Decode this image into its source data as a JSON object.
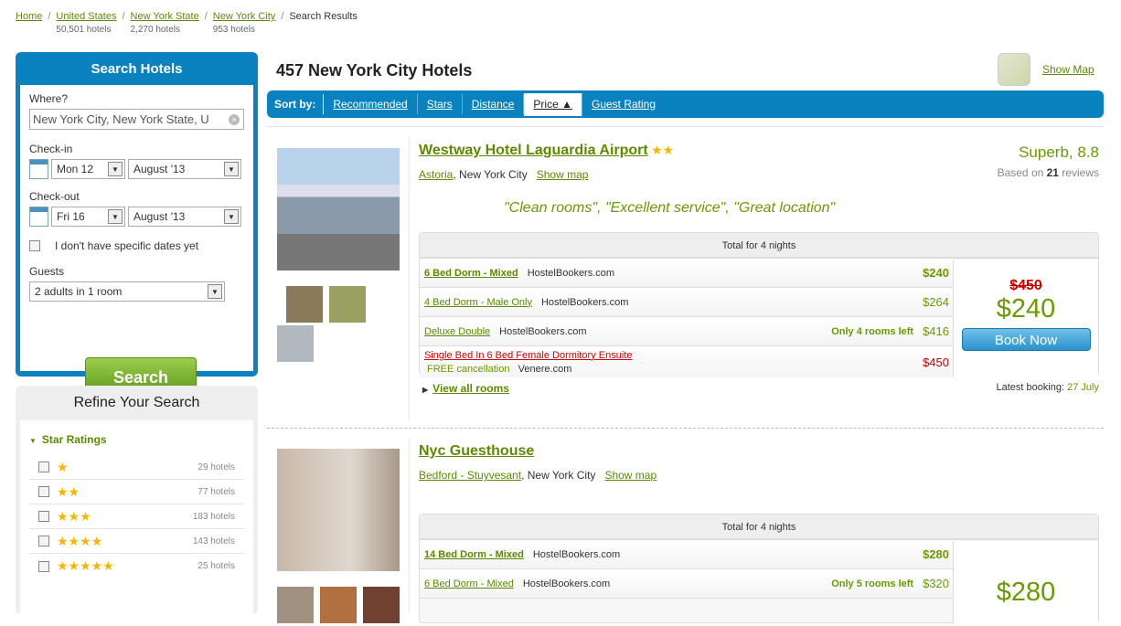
{
  "breadcrumb": [
    {
      "label": "Home",
      "count": ""
    },
    {
      "label": "United States",
      "count": "50,501 hotels"
    },
    {
      "label": "New York State",
      "count": "2,270 hotels"
    },
    {
      "label": "New York City",
      "count": "953 hotels"
    },
    {
      "label": "Search Results",
      "count": ""
    }
  ],
  "search": {
    "title": "Search Hotels",
    "where_label": "Where?",
    "where_value": "New York City, New York State, U",
    "checkin_label": "Check-in",
    "checkin_day": "Mon 12",
    "checkin_month": "August '13",
    "checkout_label": "Check-out",
    "checkout_day": "Fri 16",
    "checkout_month": "August '13",
    "no_dates_label": "I don't have specific dates yet",
    "guests_label": "Guests",
    "guests_value": "2 adults in 1 room",
    "button": "Search"
  },
  "refine": {
    "title": "Refine Your Search",
    "section": "Star Ratings",
    "items": [
      {
        "stars": "★",
        "count": "29 hotels"
      },
      {
        "stars": "★★",
        "count": "77 hotels"
      },
      {
        "stars": "★★★",
        "count": "183 hotels"
      },
      {
        "stars": "★★★★",
        "count": "143 hotels"
      },
      {
        "stars": "★★★★★",
        "count": "25 hotels"
      }
    ]
  },
  "main": {
    "title": "457 New York City Hotels",
    "show_map": "Show Map",
    "sort_label": "Sort by:",
    "sort_options": [
      "Recommended",
      "Stars",
      "Distance",
      "Price ▲",
      "Guest Rating"
    ],
    "active_sort": "Price"
  },
  "hotels": [
    {
      "name": "Westway Hotel Laguardia Airport",
      "stars": "★★",
      "area": "Astoria",
      "city": ", New York City",
      "show_map": "Show map",
      "rating": "Superb, 8.8",
      "reviews_prefix": "Based on ",
      "reviews_count": "21",
      "reviews_suffix": " reviews",
      "quote": "\"Clean rooms\",  \"Excellent service\",  \"Great location\"",
      "total_label": "Total for 4 nights",
      "rooms": [
        {
          "name": "6 Bed Dorm - Mixed",
          "provider": "HostelBookers.com",
          "price": "$240",
          "note": ""
        },
        {
          "name": "4 Bed Dorm - Male Only",
          "provider": "HostelBookers.com",
          "price": "$264",
          "note": ""
        },
        {
          "name": "Deluxe Double",
          "provider": "HostelBookers.com",
          "price": "$416",
          "note": "Only 4 rooms left"
        },
        {
          "name": "Single Bed In 6 Bed Female Dormitory Ensuite",
          "provider": "Venere.com",
          "price": "$450",
          "note": "FREE cancellation"
        }
      ],
      "old_price": "$450",
      "best_price": "$240",
      "book": "Book Now",
      "view_all": "View all rooms",
      "latest_label": "Latest booking: ",
      "latest_date": "27 July"
    },
    {
      "name": "Nyc Guesthouse",
      "area": "Bedford - Stuyvesant",
      "city": ", New York City",
      "show_map": "Show map",
      "total_label": "Total for 4 nights",
      "rooms": [
        {
          "name": "14 Bed Dorm - Mixed",
          "provider": "HostelBookers.com",
          "price": "$280",
          "note": ""
        },
        {
          "name": "6 Bed Dorm - Mixed",
          "provider": "HostelBookers.com",
          "price": "$320",
          "note": "Only 5 rooms left"
        }
      ],
      "best_price": "$280"
    }
  ]
}
